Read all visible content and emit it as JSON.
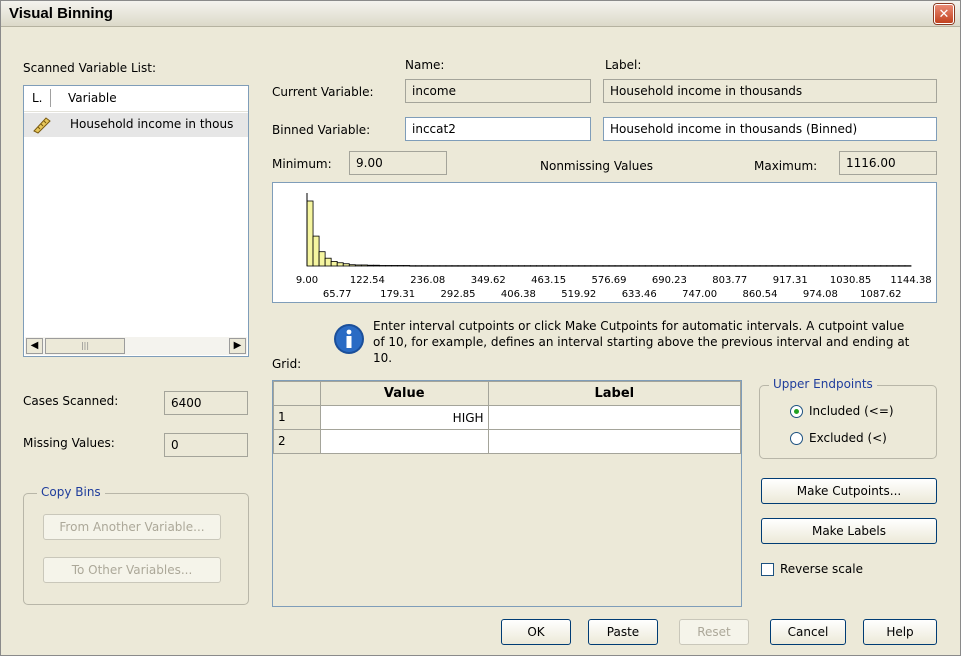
{
  "window": {
    "title": "Visual Binning",
    "close_glyph": "✕"
  },
  "scanned": {
    "label": "Scanned Variable List:",
    "col_l": "L.",
    "col_variable": "Variable",
    "items": [
      {
        "icon": "ruler-icon",
        "label": "Household income in thous"
      }
    ],
    "scroll_left": "◀",
    "scroll_right": "▶",
    "scroll_thumb": "|||"
  },
  "headers": {
    "name": "Name:",
    "label": "Label:"
  },
  "current_variable": {
    "label": "Current Variable:",
    "name": "income",
    "var_label": "Household income in thousands"
  },
  "binned_variable": {
    "label": "Binned Variable:",
    "name": "inccat2",
    "var_label": "Household income in thousands (Binned)"
  },
  "stats": {
    "minimum_label": "Minimum:",
    "minimum": "9.00",
    "nonmissing_label": "Nonmissing Values",
    "maximum_label": "Maximum:",
    "maximum": "1116.00"
  },
  "chart_data": {
    "type": "bar",
    "bar_values": [
      100,
      46,
      22,
      12,
      7,
      5,
      3.5,
      2,
      1.6,
      1.6,
      1.2,
      1.2,
      0.8,
      0.8,
      0.8,
      0.8,
      0.8,
      0.5,
      0.5,
      0.5,
      0.5,
      0.5,
      0.5,
      0.5,
      0.5,
      0.5,
      0.5,
      0.5,
      0.5,
      0.5,
      0.5,
      0.5,
      0.5,
      0.5,
      0.5,
      0.5,
      0.5,
      0.5,
      0.5,
      0.5,
      0.5,
      0.5,
      0.5,
      0.5,
      0.5,
      0.5,
      0.5,
      0.5,
      0.5,
      0.5,
      0.5,
      0.5,
      0.5,
      0.5,
      0.5,
      0.5,
      0.5,
      0.5,
      0.5,
      0.5,
      0.5,
      0.5,
      0.5,
      0.5,
      0.5,
      0.5,
      0.5,
      0.5,
      0.5,
      0.5,
      0.5,
      0.5,
      0.5,
      0.5,
      0.5,
      0.5,
      0.5,
      0.5,
      0.5,
      0.5,
      0.5,
      0.5,
      0.5,
      0.5,
      0.5,
      0.5,
      0.5,
      0.5,
      0.5,
      0.5,
      0.5,
      0.5,
      0.5,
      0.5,
      0.5,
      0.5,
      0.5,
      0.5,
      0.5,
      0.5
    ],
    "bar_fill": "#f5f5a0",
    "ticks_top": [
      "9.00",
      "122.54",
      "236.08",
      "349.62",
      "463.15",
      "576.69",
      "690.23",
      "803.77",
      "917.31",
      "1030.85",
      "1144.38"
    ],
    "ticks_bottom": [
      "65.77",
      "179.31",
      "292.85",
      "406.38",
      "519.92",
      "633.46",
      "747.00",
      "860.54",
      "974.08",
      "1087.62"
    ],
    "x_min": 9.0,
    "x_max": 1144.38
  },
  "info_text": [
    "Enter interval cutpoints or click Make Cutpoints for automatic intervals.  A cutpoint value",
    "of 10, for example, defines an interval starting above the previous interval and ending at",
    "10."
  ],
  "grid": {
    "label": "Grid:",
    "columns": [
      "Value",
      "Label"
    ],
    "rows": [
      {
        "num": "1",
        "value": "HIGH",
        "label": ""
      },
      {
        "num": "2",
        "value": "",
        "label": ""
      }
    ]
  },
  "cases_scanned": {
    "label": "Cases Scanned:",
    "value": "6400"
  },
  "missing_values": {
    "label": "Missing Values:",
    "value": "0"
  },
  "copy_bins": {
    "title": "Copy Bins",
    "from_label": "From Another Variable...",
    "to_label": "To Other Variables..."
  },
  "upper_endpoints": {
    "title": "Upper Endpoints",
    "included": "Included (<=)",
    "excluded": "Excluded (<)",
    "selected": "included"
  },
  "buttons": {
    "make_cutpoints": "Make Cutpoints...",
    "make_labels": "Make Labels",
    "reverse_scale": "Reverse scale",
    "ok": "OK",
    "paste": "Paste",
    "reset": "Reset",
    "cancel": "Cancel",
    "help": "Help"
  }
}
